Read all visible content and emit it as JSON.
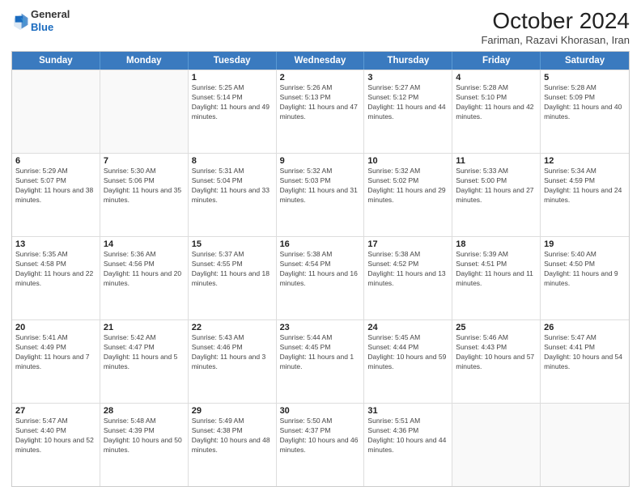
{
  "header": {
    "logo_line1": "General",
    "logo_line2": "Blue",
    "month_title": "October 2024",
    "subtitle": "Fariman, Razavi Khorasan, Iran"
  },
  "weekdays": [
    "Sunday",
    "Monday",
    "Tuesday",
    "Wednesday",
    "Thursday",
    "Friday",
    "Saturday"
  ],
  "rows": [
    [
      {
        "day": "",
        "sunrise": "",
        "sunset": "",
        "daylight": ""
      },
      {
        "day": "",
        "sunrise": "",
        "sunset": "",
        "daylight": ""
      },
      {
        "day": "1",
        "sunrise": "Sunrise: 5:25 AM",
        "sunset": "Sunset: 5:14 PM",
        "daylight": "Daylight: 11 hours and 49 minutes."
      },
      {
        "day": "2",
        "sunrise": "Sunrise: 5:26 AM",
        "sunset": "Sunset: 5:13 PM",
        "daylight": "Daylight: 11 hours and 47 minutes."
      },
      {
        "day": "3",
        "sunrise": "Sunrise: 5:27 AM",
        "sunset": "Sunset: 5:12 PM",
        "daylight": "Daylight: 11 hours and 44 minutes."
      },
      {
        "day": "4",
        "sunrise": "Sunrise: 5:28 AM",
        "sunset": "Sunset: 5:10 PM",
        "daylight": "Daylight: 11 hours and 42 minutes."
      },
      {
        "day": "5",
        "sunrise": "Sunrise: 5:28 AM",
        "sunset": "Sunset: 5:09 PM",
        "daylight": "Daylight: 11 hours and 40 minutes."
      }
    ],
    [
      {
        "day": "6",
        "sunrise": "Sunrise: 5:29 AM",
        "sunset": "Sunset: 5:07 PM",
        "daylight": "Daylight: 11 hours and 38 minutes."
      },
      {
        "day": "7",
        "sunrise": "Sunrise: 5:30 AM",
        "sunset": "Sunset: 5:06 PM",
        "daylight": "Daylight: 11 hours and 35 minutes."
      },
      {
        "day": "8",
        "sunrise": "Sunrise: 5:31 AM",
        "sunset": "Sunset: 5:04 PM",
        "daylight": "Daylight: 11 hours and 33 minutes."
      },
      {
        "day": "9",
        "sunrise": "Sunrise: 5:32 AM",
        "sunset": "Sunset: 5:03 PM",
        "daylight": "Daylight: 11 hours and 31 minutes."
      },
      {
        "day": "10",
        "sunrise": "Sunrise: 5:32 AM",
        "sunset": "Sunset: 5:02 PM",
        "daylight": "Daylight: 11 hours and 29 minutes."
      },
      {
        "day": "11",
        "sunrise": "Sunrise: 5:33 AM",
        "sunset": "Sunset: 5:00 PM",
        "daylight": "Daylight: 11 hours and 27 minutes."
      },
      {
        "day": "12",
        "sunrise": "Sunrise: 5:34 AM",
        "sunset": "Sunset: 4:59 PM",
        "daylight": "Daylight: 11 hours and 24 minutes."
      }
    ],
    [
      {
        "day": "13",
        "sunrise": "Sunrise: 5:35 AM",
        "sunset": "Sunset: 4:58 PM",
        "daylight": "Daylight: 11 hours and 22 minutes."
      },
      {
        "day": "14",
        "sunrise": "Sunrise: 5:36 AM",
        "sunset": "Sunset: 4:56 PM",
        "daylight": "Daylight: 11 hours and 20 minutes."
      },
      {
        "day": "15",
        "sunrise": "Sunrise: 5:37 AM",
        "sunset": "Sunset: 4:55 PM",
        "daylight": "Daylight: 11 hours and 18 minutes."
      },
      {
        "day": "16",
        "sunrise": "Sunrise: 5:38 AM",
        "sunset": "Sunset: 4:54 PM",
        "daylight": "Daylight: 11 hours and 16 minutes."
      },
      {
        "day": "17",
        "sunrise": "Sunrise: 5:38 AM",
        "sunset": "Sunset: 4:52 PM",
        "daylight": "Daylight: 11 hours and 13 minutes."
      },
      {
        "day": "18",
        "sunrise": "Sunrise: 5:39 AM",
        "sunset": "Sunset: 4:51 PM",
        "daylight": "Daylight: 11 hours and 11 minutes."
      },
      {
        "day": "19",
        "sunrise": "Sunrise: 5:40 AM",
        "sunset": "Sunset: 4:50 PM",
        "daylight": "Daylight: 11 hours and 9 minutes."
      }
    ],
    [
      {
        "day": "20",
        "sunrise": "Sunrise: 5:41 AM",
        "sunset": "Sunset: 4:49 PM",
        "daylight": "Daylight: 11 hours and 7 minutes."
      },
      {
        "day": "21",
        "sunrise": "Sunrise: 5:42 AM",
        "sunset": "Sunset: 4:47 PM",
        "daylight": "Daylight: 11 hours and 5 minutes."
      },
      {
        "day": "22",
        "sunrise": "Sunrise: 5:43 AM",
        "sunset": "Sunset: 4:46 PM",
        "daylight": "Daylight: 11 hours and 3 minutes."
      },
      {
        "day": "23",
        "sunrise": "Sunrise: 5:44 AM",
        "sunset": "Sunset: 4:45 PM",
        "daylight": "Daylight: 11 hours and 1 minute."
      },
      {
        "day": "24",
        "sunrise": "Sunrise: 5:45 AM",
        "sunset": "Sunset: 4:44 PM",
        "daylight": "Daylight: 10 hours and 59 minutes."
      },
      {
        "day": "25",
        "sunrise": "Sunrise: 5:46 AM",
        "sunset": "Sunset: 4:43 PM",
        "daylight": "Daylight: 10 hours and 57 minutes."
      },
      {
        "day": "26",
        "sunrise": "Sunrise: 5:47 AM",
        "sunset": "Sunset: 4:41 PM",
        "daylight": "Daylight: 10 hours and 54 minutes."
      }
    ],
    [
      {
        "day": "27",
        "sunrise": "Sunrise: 5:47 AM",
        "sunset": "Sunset: 4:40 PM",
        "daylight": "Daylight: 10 hours and 52 minutes."
      },
      {
        "day": "28",
        "sunrise": "Sunrise: 5:48 AM",
        "sunset": "Sunset: 4:39 PM",
        "daylight": "Daylight: 10 hours and 50 minutes."
      },
      {
        "day": "29",
        "sunrise": "Sunrise: 5:49 AM",
        "sunset": "Sunset: 4:38 PM",
        "daylight": "Daylight: 10 hours and 48 minutes."
      },
      {
        "day": "30",
        "sunrise": "Sunrise: 5:50 AM",
        "sunset": "Sunset: 4:37 PM",
        "daylight": "Daylight: 10 hours and 46 minutes."
      },
      {
        "day": "31",
        "sunrise": "Sunrise: 5:51 AM",
        "sunset": "Sunset: 4:36 PM",
        "daylight": "Daylight: 10 hours and 44 minutes."
      },
      {
        "day": "",
        "sunrise": "",
        "sunset": "",
        "daylight": ""
      },
      {
        "day": "",
        "sunrise": "",
        "sunset": "",
        "daylight": ""
      }
    ]
  ]
}
